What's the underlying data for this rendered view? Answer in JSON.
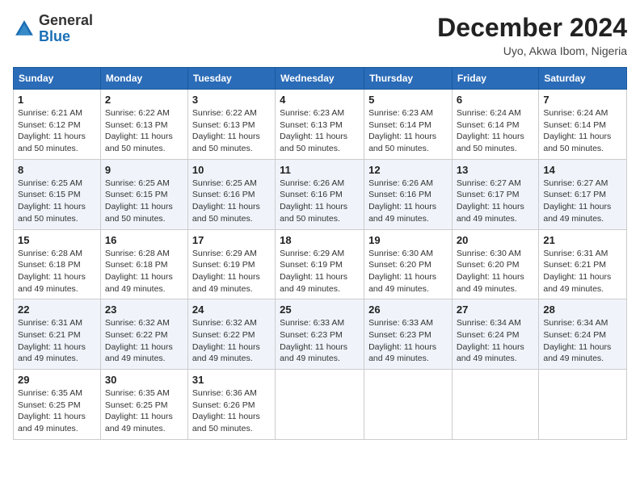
{
  "logo": {
    "general": "General",
    "blue": "Blue"
  },
  "title": "December 2024",
  "subtitle": "Uyo, Akwa Ibom, Nigeria",
  "days_of_week": [
    "Sunday",
    "Monday",
    "Tuesday",
    "Wednesday",
    "Thursday",
    "Friday",
    "Saturday"
  ],
  "weeks": [
    [
      {
        "day": "1",
        "sunrise": "Sunrise: 6:21 AM",
        "sunset": "Sunset: 6:12 PM",
        "daylight": "Daylight: 11 hours and 50 minutes."
      },
      {
        "day": "2",
        "sunrise": "Sunrise: 6:22 AM",
        "sunset": "Sunset: 6:13 PM",
        "daylight": "Daylight: 11 hours and 50 minutes."
      },
      {
        "day": "3",
        "sunrise": "Sunrise: 6:22 AM",
        "sunset": "Sunset: 6:13 PM",
        "daylight": "Daylight: 11 hours and 50 minutes."
      },
      {
        "day": "4",
        "sunrise": "Sunrise: 6:23 AM",
        "sunset": "Sunset: 6:13 PM",
        "daylight": "Daylight: 11 hours and 50 minutes."
      },
      {
        "day": "5",
        "sunrise": "Sunrise: 6:23 AM",
        "sunset": "Sunset: 6:14 PM",
        "daylight": "Daylight: 11 hours and 50 minutes."
      },
      {
        "day": "6",
        "sunrise": "Sunrise: 6:24 AM",
        "sunset": "Sunset: 6:14 PM",
        "daylight": "Daylight: 11 hours and 50 minutes."
      },
      {
        "day": "7",
        "sunrise": "Sunrise: 6:24 AM",
        "sunset": "Sunset: 6:14 PM",
        "daylight": "Daylight: 11 hours and 50 minutes."
      }
    ],
    [
      {
        "day": "8",
        "sunrise": "Sunrise: 6:25 AM",
        "sunset": "Sunset: 6:15 PM",
        "daylight": "Daylight: 11 hours and 50 minutes."
      },
      {
        "day": "9",
        "sunrise": "Sunrise: 6:25 AM",
        "sunset": "Sunset: 6:15 PM",
        "daylight": "Daylight: 11 hours and 50 minutes."
      },
      {
        "day": "10",
        "sunrise": "Sunrise: 6:25 AM",
        "sunset": "Sunset: 6:16 PM",
        "daylight": "Daylight: 11 hours and 50 minutes."
      },
      {
        "day": "11",
        "sunrise": "Sunrise: 6:26 AM",
        "sunset": "Sunset: 6:16 PM",
        "daylight": "Daylight: 11 hours and 50 minutes."
      },
      {
        "day": "12",
        "sunrise": "Sunrise: 6:26 AM",
        "sunset": "Sunset: 6:16 PM",
        "daylight": "Daylight: 11 hours and 49 minutes."
      },
      {
        "day": "13",
        "sunrise": "Sunrise: 6:27 AM",
        "sunset": "Sunset: 6:17 PM",
        "daylight": "Daylight: 11 hours and 49 minutes."
      },
      {
        "day": "14",
        "sunrise": "Sunrise: 6:27 AM",
        "sunset": "Sunset: 6:17 PM",
        "daylight": "Daylight: 11 hours and 49 minutes."
      }
    ],
    [
      {
        "day": "15",
        "sunrise": "Sunrise: 6:28 AM",
        "sunset": "Sunset: 6:18 PM",
        "daylight": "Daylight: 11 hours and 49 minutes."
      },
      {
        "day": "16",
        "sunrise": "Sunrise: 6:28 AM",
        "sunset": "Sunset: 6:18 PM",
        "daylight": "Daylight: 11 hours and 49 minutes."
      },
      {
        "day": "17",
        "sunrise": "Sunrise: 6:29 AM",
        "sunset": "Sunset: 6:19 PM",
        "daylight": "Daylight: 11 hours and 49 minutes."
      },
      {
        "day": "18",
        "sunrise": "Sunrise: 6:29 AM",
        "sunset": "Sunset: 6:19 PM",
        "daylight": "Daylight: 11 hours and 49 minutes."
      },
      {
        "day": "19",
        "sunrise": "Sunrise: 6:30 AM",
        "sunset": "Sunset: 6:20 PM",
        "daylight": "Daylight: 11 hours and 49 minutes."
      },
      {
        "day": "20",
        "sunrise": "Sunrise: 6:30 AM",
        "sunset": "Sunset: 6:20 PM",
        "daylight": "Daylight: 11 hours and 49 minutes."
      },
      {
        "day": "21",
        "sunrise": "Sunrise: 6:31 AM",
        "sunset": "Sunset: 6:21 PM",
        "daylight": "Daylight: 11 hours and 49 minutes."
      }
    ],
    [
      {
        "day": "22",
        "sunrise": "Sunrise: 6:31 AM",
        "sunset": "Sunset: 6:21 PM",
        "daylight": "Daylight: 11 hours and 49 minutes."
      },
      {
        "day": "23",
        "sunrise": "Sunrise: 6:32 AM",
        "sunset": "Sunset: 6:22 PM",
        "daylight": "Daylight: 11 hours and 49 minutes."
      },
      {
        "day": "24",
        "sunrise": "Sunrise: 6:32 AM",
        "sunset": "Sunset: 6:22 PM",
        "daylight": "Daylight: 11 hours and 49 minutes."
      },
      {
        "day": "25",
        "sunrise": "Sunrise: 6:33 AM",
        "sunset": "Sunset: 6:23 PM",
        "daylight": "Daylight: 11 hours and 49 minutes."
      },
      {
        "day": "26",
        "sunrise": "Sunrise: 6:33 AM",
        "sunset": "Sunset: 6:23 PM",
        "daylight": "Daylight: 11 hours and 49 minutes."
      },
      {
        "day": "27",
        "sunrise": "Sunrise: 6:34 AM",
        "sunset": "Sunset: 6:24 PM",
        "daylight": "Daylight: 11 hours and 49 minutes."
      },
      {
        "day": "28",
        "sunrise": "Sunrise: 6:34 AM",
        "sunset": "Sunset: 6:24 PM",
        "daylight": "Daylight: 11 hours and 49 minutes."
      }
    ],
    [
      {
        "day": "29",
        "sunrise": "Sunrise: 6:35 AM",
        "sunset": "Sunset: 6:25 PM",
        "daylight": "Daylight: 11 hours and 49 minutes."
      },
      {
        "day": "30",
        "sunrise": "Sunrise: 6:35 AM",
        "sunset": "Sunset: 6:25 PM",
        "daylight": "Daylight: 11 hours and 49 minutes."
      },
      {
        "day": "31",
        "sunrise": "Sunrise: 6:36 AM",
        "sunset": "Sunset: 6:26 PM",
        "daylight": "Daylight: 11 hours and 50 minutes."
      },
      null,
      null,
      null,
      null
    ]
  ]
}
